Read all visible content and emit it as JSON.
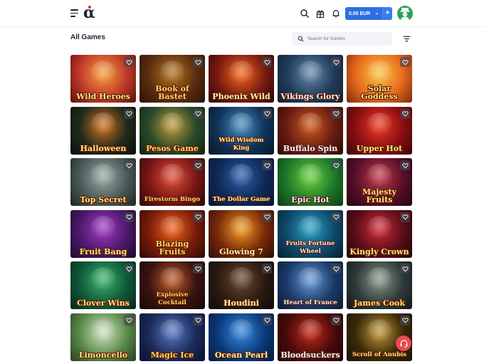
{
  "header": {
    "logo_text": "α",
    "balance": "0.00 EUR",
    "balance_chevron": "⌄",
    "deposit_label": "+",
    "icons": [
      "menu-icon",
      "search-icon",
      "gift-icon",
      "bell-icon",
      "avatar"
    ],
    "colors": {
      "accent": "#2f6fe3",
      "avatar_bg": "#29a35a",
      "support": "#e94a50"
    }
  },
  "main": {
    "title": "All Games",
    "search_placeholder": "Search for Games"
  },
  "games": [
    {
      "name": "Wild Heroes"
    },
    {
      "name": "Book of Bastet"
    },
    {
      "name": "Phoenix Wild"
    },
    {
      "name": "Vikings Glory"
    },
    {
      "name": "Solar Goddess"
    },
    {
      "name": "Halloween"
    },
    {
      "name": "Pesos Game"
    },
    {
      "name": "Wild Wisdom King"
    },
    {
      "name": "Buffalo Spin"
    },
    {
      "name": "Upper Hot"
    },
    {
      "name": "Top Secret"
    },
    {
      "name": "Firestorm Bingo"
    },
    {
      "name": "The Dollar Game"
    },
    {
      "name": "Epic Hot"
    },
    {
      "name": "Majesty Fruits"
    },
    {
      "name": "Fruit Bang"
    },
    {
      "name": "Blazing Fruits"
    },
    {
      "name": "Glowing 7"
    },
    {
      "name": "Fruits Fortune Wheel"
    },
    {
      "name": "Kingly Crown"
    },
    {
      "name": "Clover Wins"
    },
    {
      "name": "Explosive Cocktail"
    },
    {
      "name": "Houdini"
    },
    {
      "name": "Heart of France"
    },
    {
      "name": "James Cook"
    },
    {
      "name": "Limoncello"
    },
    {
      "name": "Magic Ice"
    },
    {
      "name": "Ocean Pearl"
    },
    {
      "name": "Bloodsuckers"
    },
    {
      "name": "Scroll of Anubis"
    }
  ]
}
